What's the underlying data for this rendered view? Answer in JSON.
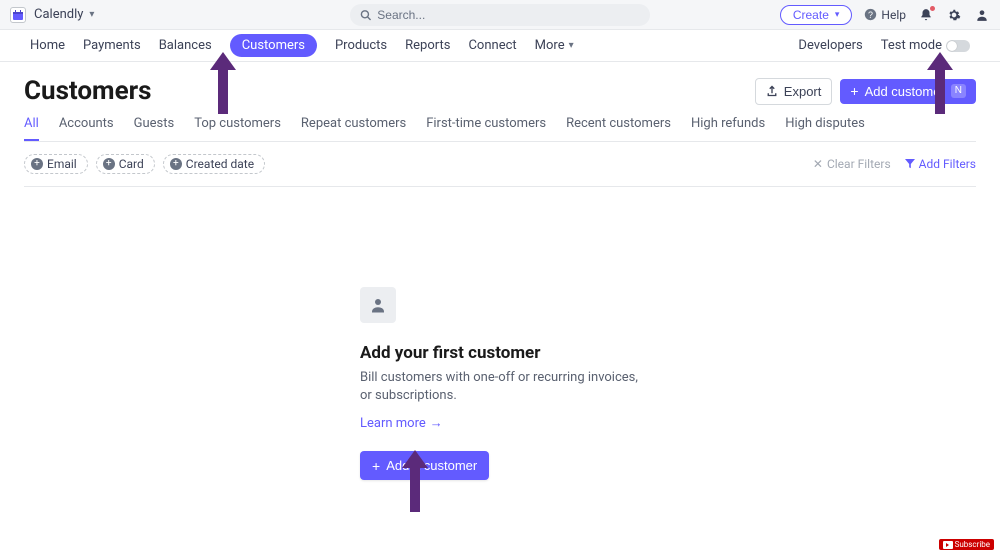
{
  "topbar": {
    "org_name": "Calendly",
    "search_placeholder": "Search...",
    "create_label": "Create",
    "help_label": "Help"
  },
  "nav": {
    "items": [
      "Home",
      "Payments",
      "Balances",
      "Customers",
      "Products",
      "Reports",
      "Connect",
      "More"
    ],
    "active_index": 3,
    "right": {
      "developers": "Developers",
      "testmode": "Test mode"
    }
  },
  "page": {
    "title": "Customers",
    "export_label": "Export",
    "add_customer_label": "Add customer",
    "add_customer_kbd": "N"
  },
  "subtabs": {
    "items": [
      "All",
      "Accounts",
      "Guests",
      "Top customers",
      "Repeat customers",
      "First-time customers",
      "Recent customers",
      "High refunds",
      "High disputes"
    ],
    "active_index": 0
  },
  "filters": {
    "chips": [
      "Email",
      "Card",
      "Created date"
    ],
    "clear_label": "Clear Filters",
    "add_label": "Add Filters"
  },
  "empty": {
    "title": "Add your first customer",
    "desc": "Bill customers with one-off or recurring invoices, or subscriptions.",
    "learn": "Learn more",
    "button": "Add a customer"
  },
  "badge": {
    "subscribe": "Subscribe"
  }
}
